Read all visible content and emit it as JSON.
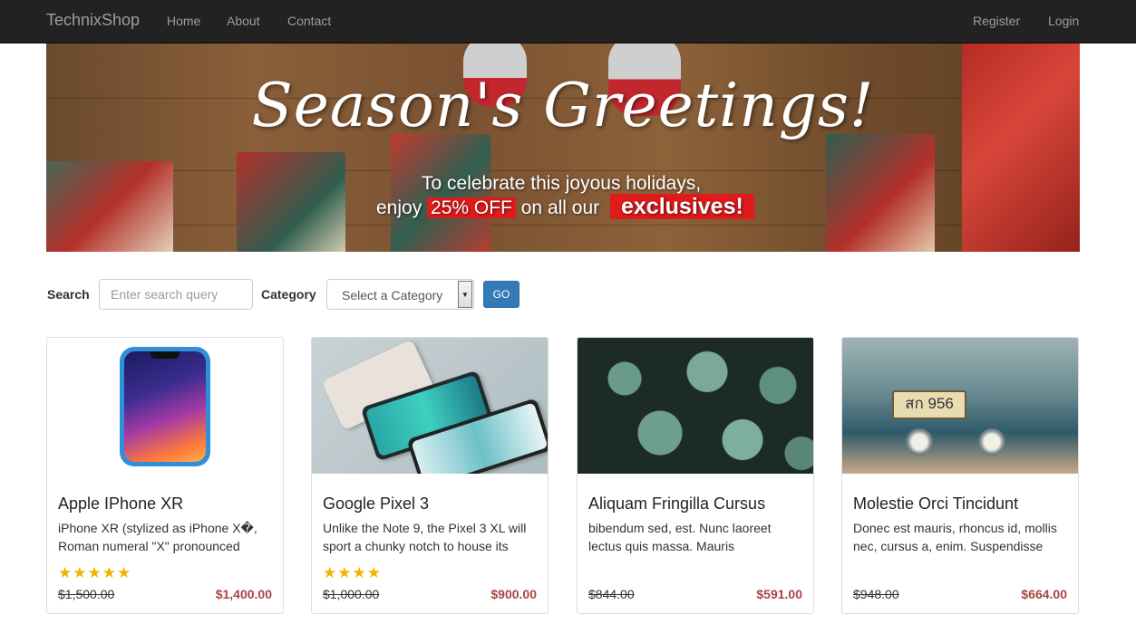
{
  "navbar": {
    "brand": "TechnixShop",
    "links": [
      "Home",
      "About",
      "Contact"
    ],
    "right_links": [
      "Register",
      "Login"
    ]
  },
  "banner": {
    "headline": "Season's Greetings!",
    "line1": "To celebrate this joyous holidays,",
    "line2_prefix": "enjoy",
    "line2_highlight": "25% OFF",
    "line2_middle": "on all our",
    "line2_highlight_big": "exclusives!"
  },
  "search": {
    "label": "Search",
    "placeholder": "Enter search query",
    "category_label": "Category",
    "category_selected": "Select a Category",
    "go_label": "GO"
  },
  "products": [
    {
      "title": "Apple IPhone XR",
      "desc": "iPhone XR (stylized as iPhone X�, Roman numeral \"X\" pronounced",
      "stars": "★★★★★",
      "old_price": "$1,500.00",
      "new_price": "$1,400.00",
      "image": "iphone-xr"
    },
    {
      "title": "Google Pixel 3",
      "desc": "Unlike the Note 9, the Pixel 3 XL will sport a chunky notch to house its",
      "stars": "★★★★",
      "old_price": "$1,000.00",
      "new_price": "$900.00",
      "image": "pixel-3"
    },
    {
      "title": "Aliquam Fringilla Cursus",
      "desc": "bibendum sed, est. Nunc laoreet lectus quis massa. Mauris",
      "stars": "",
      "old_price": "$844.00",
      "new_price": "$591.00",
      "image": "succulents"
    },
    {
      "title": "Molestie Orci Tincidunt",
      "desc": "Donec est mauris, rhoncus id, mollis nec, cursus a, enim. Suspendisse",
      "stars": "",
      "old_price": "$948.00",
      "new_price": "$664.00",
      "image": "tuk-tuk",
      "plate_text": "สก 956"
    }
  ],
  "colors": {
    "navbar_bg": "#222222",
    "primary_button": "#337ab7",
    "price_red": "#a94442",
    "star_gold": "#f0b400",
    "banner_highlight": "#e01b1b"
  }
}
